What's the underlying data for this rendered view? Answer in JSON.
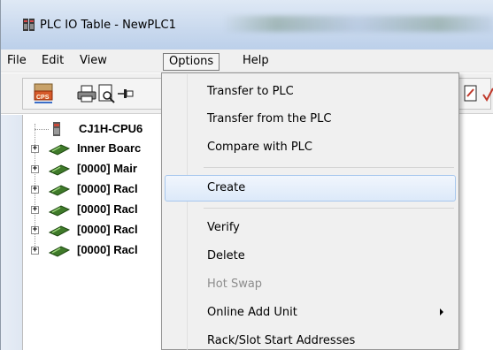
{
  "window": {
    "title": "PLC IO Table - NewPLC1"
  },
  "menubar": {
    "items": [
      "File",
      "Edit",
      "View",
      "Options",
      "Help"
    ],
    "open_menu": "Options"
  },
  "tree": {
    "root": "CJ1H-CPU6",
    "nodes": [
      "Inner Boarc",
      "[0000] Mair",
      "[0000] Racl",
      "[0000] Racl",
      "[0000] Racl"
    ]
  },
  "options_menu": {
    "items": [
      {
        "label": "Transfer to PLC",
        "enabled": true
      },
      {
        "label": "Transfer from the PLC",
        "enabled": true
      },
      {
        "label": "Compare with PLC",
        "enabled": true
      },
      {
        "label": "Create",
        "enabled": true,
        "highlighted": true
      },
      {
        "label": "Verify",
        "enabled": true
      },
      {
        "label": "Delete",
        "enabled": true
      },
      {
        "label": "Hot Swap",
        "enabled": false
      },
      {
        "label": "Online Add Unit",
        "enabled": true,
        "submenu": true
      },
      {
        "label": "Rack/Slot Start Addresses",
        "enabled": true
      }
    ]
  },
  "colors": {
    "menu_highlight_border": "#a8c8ee",
    "disabled_text": "#8d8d8d",
    "tree_icon_green": "#3f7a2a"
  }
}
